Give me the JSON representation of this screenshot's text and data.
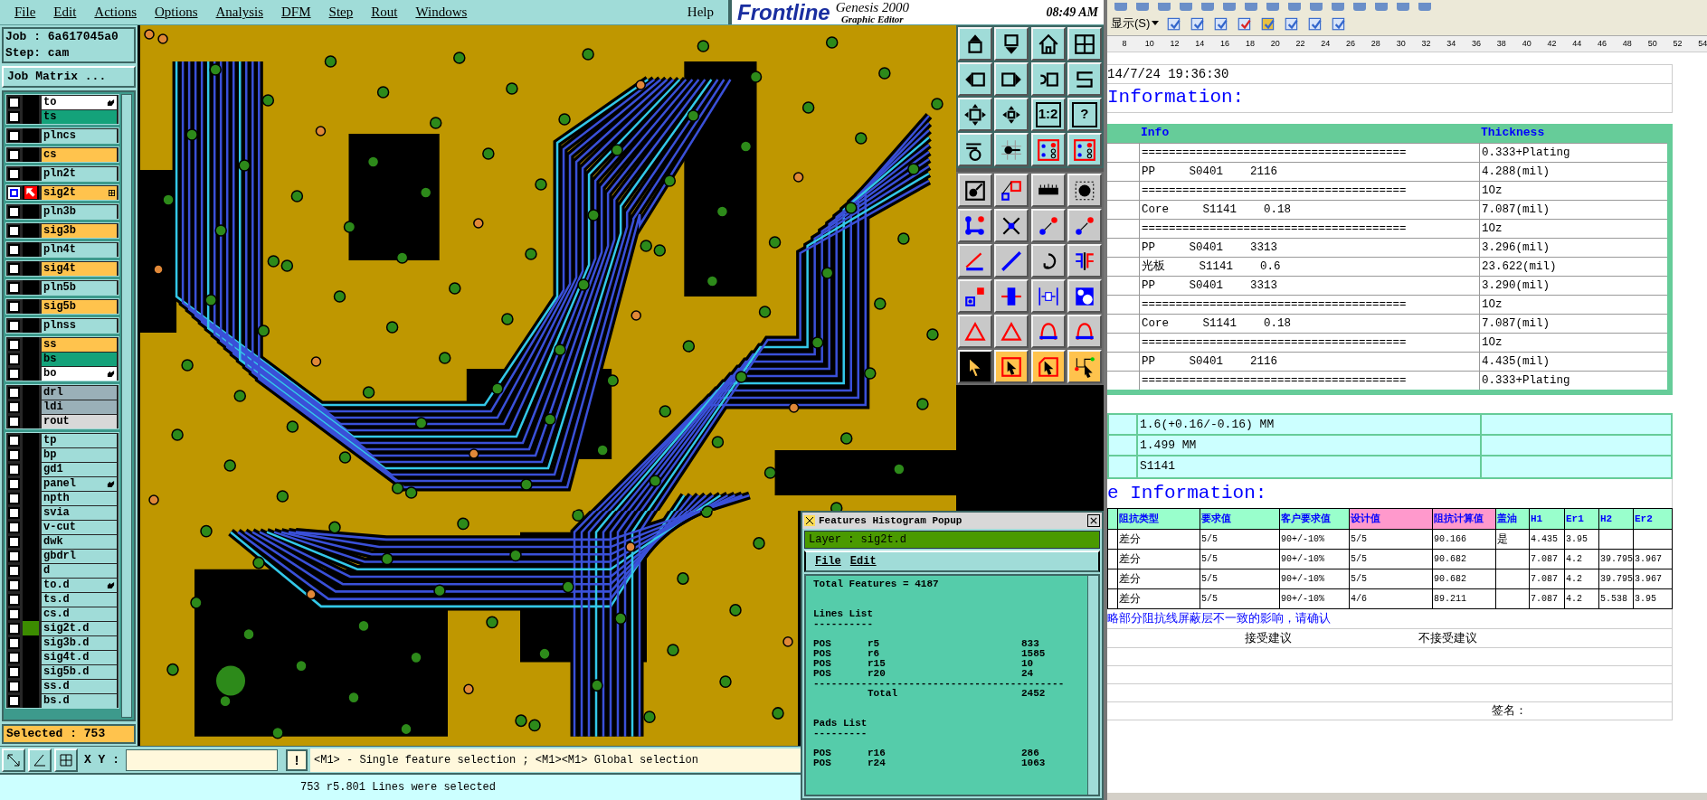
{
  "menu": [
    {
      "label": "File"
    },
    {
      "label": "Edit"
    },
    {
      "label": "Actions"
    },
    {
      "label": "Options"
    },
    {
      "label": "Analysis"
    },
    {
      "label": "DFM"
    },
    {
      "label": "Step"
    },
    {
      "label": "Rout"
    },
    {
      "label": "Windows"
    }
  ],
  "help": "Help",
  "brand": {
    "logo": "Frontline",
    "product": "Genesis 2000",
    "subtitle": "Graphic Editor",
    "clock": "08:49 AM"
  },
  "job": {
    "job": "Job :  6a617045a0",
    "step": "Step: cam",
    "matrix_button": "Job Matrix ..."
  },
  "layer_groups": [
    {
      "layers": [
        {
          "name": "to",
          "color": "#ffffff",
          "selected": false,
          "hand": true,
          "displayed": false
        },
        {
          "name": "ts",
          "color": "#14a27a",
          "selected": false,
          "hand": false,
          "displayed": false
        }
      ]
    },
    {
      "layers": [
        {
          "name": "plncs",
          "color": "#a0dcd8",
          "selected": false,
          "hand": false,
          "displayed": false
        }
      ]
    },
    {
      "layers": [
        {
          "name": "cs",
          "color": "#ffc34d",
          "selected": false,
          "hand": false,
          "displayed": false
        }
      ]
    },
    {
      "layers": [
        {
          "name": "pln2t",
          "color": "#a0dcd8",
          "selected": false,
          "hand": false,
          "displayed": false
        }
      ]
    },
    {
      "layers": [
        {
          "name": "sig2t",
          "color": "#ffc34d",
          "selected": true,
          "hand": false,
          "displayed": false
        }
      ]
    },
    {
      "layers": [
        {
          "name": "pln3b",
          "color": "#a0dcd8",
          "selected": false,
          "hand": false,
          "displayed": false
        }
      ]
    },
    {
      "layers": [
        {
          "name": "sig3b",
          "color": "#ffc34d",
          "selected": false,
          "hand": false,
          "displayed": false
        }
      ]
    },
    {
      "layers": [
        {
          "name": "pln4t",
          "color": "#a0dcd8",
          "selected": false,
          "hand": false,
          "displayed": false
        }
      ]
    },
    {
      "layers": [
        {
          "name": "sig4t",
          "color": "#ffc34d",
          "selected": false,
          "hand": false,
          "displayed": false
        }
      ]
    },
    {
      "layers": [
        {
          "name": "pln5b",
          "color": "#a0dcd8",
          "selected": false,
          "hand": false,
          "displayed": false
        }
      ]
    },
    {
      "layers": [
        {
          "name": "sig5b",
          "color": "#ffc34d",
          "selected": false,
          "hand": false,
          "displayed": false
        }
      ]
    },
    {
      "layers": [
        {
          "name": "plnss",
          "color": "#a0dcd8",
          "selected": false,
          "hand": false,
          "displayed": false
        }
      ]
    },
    {
      "layers": [
        {
          "name": "ss",
          "color": "#ffc34d",
          "selected": false,
          "hand": false,
          "displayed": false
        },
        {
          "name": "bs",
          "color": "#14a27a",
          "selected": false,
          "hand": false,
          "displayed": false
        },
        {
          "name": "bo",
          "color": "#ffffff",
          "selected": false,
          "hand": true,
          "displayed": false
        }
      ]
    },
    {
      "layers": [
        {
          "name": "drl",
          "color": "#9ab0b8",
          "selected": false,
          "hand": false,
          "displayed": false
        },
        {
          "name": "ldi",
          "color": "#9ab0b8",
          "selected": false,
          "hand": false,
          "displayed": false
        },
        {
          "name": "rout",
          "color": "#d8d8d8",
          "selected": false,
          "hand": false,
          "displayed": false
        }
      ]
    },
    {
      "layers": [
        {
          "name": "tp",
          "color": "#a0dcd8",
          "selected": false,
          "hand": false,
          "displayed": false
        },
        {
          "name": "bp",
          "color": "#a0dcd8",
          "selected": false,
          "hand": false,
          "displayed": false
        },
        {
          "name": "gd1",
          "color": "#a0dcd8",
          "selected": false,
          "hand": false,
          "displayed": false
        },
        {
          "name": "panel",
          "color": "#a0dcd8",
          "selected": false,
          "hand": true,
          "displayed": false
        },
        {
          "name": "npth",
          "color": "#a0dcd8",
          "selected": false,
          "hand": false,
          "displayed": false
        },
        {
          "name": "svia",
          "color": "#a0dcd8",
          "selected": false,
          "hand": false,
          "displayed": false
        },
        {
          "name": "v-cut",
          "color": "#a0dcd8",
          "selected": false,
          "hand": false,
          "displayed": false
        },
        {
          "name": "dwk",
          "color": "#a0dcd8",
          "selected": false,
          "hand": false,
          "displayed": false
        },
        {
          "name": "gbdrl",
          "color": "#a0dcd8",
          "selected": false,
          "hand": false,
          "displayed": false
        },
        {
          "name": "d",
          "color": "#a0dcd8",
          "selected": false,
          "hand": false,
          "displayed": false
        },
        {
          "name": "to.d",
          "color": "#a0dcd8",
          "selected": false,
          "hand": true,
          "displayed": false
        },
        {
          "name": "ts.d",
          "color": "#a0dcd8",
          "selected": false,
          "hand": false,
          "displayed": false
        },
        {
          "name": "cs.d",
          "color": "#a0dcd8",
          "selected": false,
          "hand": false,
          "displayed": false
        },
        {
          "name": "sig2t.d",
          "color": "#a0dcd8",
          "selected": false,
          "hand": false,
          "displayed": true
        },
        {
          "name": "sig3b.d",
          "color": "#a0dcd8",
          "selected": false,
          "hand": false,
          "displayed": false
        },
        {
          "name": "sig4t.d",
          "color": "#a0dcd8",
          "selected": false,
          "hand": false,
          "displayed": false
        },
        {
          "name": "sig5b.d",
          "color": "#a0dcd8",
          "selected": false,
          "hand": false,
          "displayed": false
        },
        {
          "name": "ss.d",
          "color": "#a0dcd8",
          "selected": false,
          "hand": false,
          "displayed": false
        },
        {
          "name": "bs.d",
          "color": "#a0dcd8",
          "selected": false,
          "hand": false,
          "displayed": false
        }
      ]
    }
  ],
  "selected_count": "Selected : 753",
  "view_tools": [
    {
      "kind": "box-up",
      "selected": false
    },
    {
      "kind": "box-down",
      "selected": false
    },
    {
      "kind": "house",
      "selected": false
    },
    {
      "kind": "window",
      "selected": false
    },
    {
      "kind": "box-left",
      "selected": false
    },
    {
      "kind": "box-right",
      "selected": false
    },
    {
      "kind": "undo-box",
      "selected": false
    },
    {
      "kind": "route",
      "selected": false
    },
    {
      "kind": "expand",
      "selected": false
    },
    {
      "kind": "shrink",
      "selected": false
    },
    {
      "kind": "text",
      "selected": false,
      "label": "1:2"
    },
    {
      "kind": "text",
      "selected": false,
      "label": "?"
    },
    {
      "kind": "wrench",
      "selected": false
    },
    {
      "kind": "pad-grid",
      "selected": false
    },
    {
      "kind": "board",
      "selected": false
    },
    {
      "kind": "board",
      "selected": false
    }
  ],
  "edit_tools": [
    {
      "kind": "pad-move",
      "selected": false
    },
    {
      "kind": "copy-box",
      "selected": false
    },
    {
      "kind": "ruler",
      "selected": false
    },
    {
      "kind": "pad-frame",
      "selected": false
    },
    {
      "kind": "nodes",
      "selected": false
    },
    {
      "kind": "cross",
      "selected": false
    },
    {
      "kind": "node-link",
      "selected": false
    },
    {
      "kind": "node-link",
      "selected": false
    },
    {
      "kind": "line-red",
      "selected": false
    },
    {
      "kind": "line-blue",
      "selected": false
    },
    {
      "kind": "rotate",
      "selected": false
    },
    {
      "kind": "mirror",
      "selected": false
    },
    {
      "kind": "pad-copy",
      "selected": false
    },
    {
      "kind": "line-join",
      "selected": false
    },
    {
      "kind": "spacing",
      "selected": false
    },
    {
      "kind": "blob",
      "selected": false
    },
    {
      "kind": "triangle",
      "selected": false
    },
    {
      "kind": "triangle",
      "selected": false
    },
    {
      "kind": "arch",
      "selected": false
    },
    {
      "kind": "arch",
      "selected": false
    }
  ],
  "select_tools": [
    {
      "kind": "select-arrow",
      "selected": true
    },
    {
      "kind": "select-box",
      "selected": false
    },
    {
      "kind": "select-poly",
      "selected": false
    },
    {
      "kind": "select-net",
      "selected": false
    }
  ],
  "alert_button": "!",
  "xy": {
    "label": "X Y :"
  },
  "hint": "<M1> - Single feature selection ; <M1><M1> Global selection",
  "status": "753 r5.801 Lines were selected",
  "popup": {
    "title": "Features Histogram Popup",
    "layer": "Layer :  sig2t.d",
    "menu": [
      "File",
      "Edit"
    ],
    "total": "Total Features = 4187",
    "sections": [
      {
        "title": "Lines List",
        "underline": "----------",
        "rows": [
          [
            "POS",
            "r5",
            "833"
          ],
          [
            "POS",
            "r6",
            "1585"
          ],
          [
            "POS",
            "r15",
            "10"
          ],
          [
            "POS",
            "r20",
            "24"
          ]
        ],
        "separator": "------------------------------------------",
        "total_label": "Total",
        "total": "2452"
      },
      {
        "title": "Pads List",
        "underline": "---------",
        "rows": [
          [
            "POS",
            "r16",
            "286"
          ],
          [
            "POS",
            "r24",
            "1063"
          ]
        ]
      }
    ]
  },
  "doc": {
    "view_menu": "显示(S)",
    "ruler": [
      "8",
      "10",
      "12",
      "14",
      "16",
      "18",
      "20",
      "22",
      "24",
      "26",
      "28",
      "30",
      "32",
      "34",
      "36",
      "38",
      "40",
      "42",
      "44",
      "46",
      "48",
      "50",
      "52",
      "54"
    ],
    "date": "14/7/24 19:36:30",
    "heading1": "Information:",
    "stack": {
      "columns": [
        "Info",
        "Thickness"
      ],
      "rows": [
        [
          "=======================================",
          "0.333+Plating"
        ],
        [
          "PP     S0401    2116",
          "4.288(mil)"
        ],
        [
          "=======================================",
          "1Oz"
        ],
        [
          "Core     S1141    0.18",
          "7.087(mil)"
        ],
        [
          "=======================================",
          "1Oz"
        ],
        [
          "PP     S0401    3313",
          "3.296(mil)"
        ],
        [
          "光板     S1141    0.6",
          "23.622(mil)"
        ],
        [
          "PP     S0401    3313",
          "3.290(mil)"
        ],
        [
          "=======================================",
          "1Oz"
        ],
        [
          "Core     S1141    0.18",
          "7.087(mil)"
        ],
        [
          "=======================================",
          "1Oz"
        ],
        [
          "PP     S0401    2116",
          "4.435(mil)"
        ],
        [
          "=======================================",
          "0.333+Plating"
        ]
      ]
    },
    "board": [
      "1.6(+0.16/-0.16) MM",
      "1.499 MM",
      "S1141"
    ],
    "heading2": "e Information:",
    "impedance": {
      "columns": [
        {
          "label": "阻抗类型",
          "highlight": false
        },
        {
          "label": "要求值",
          "highlight": false
        },
        {
          "label": "客户要求值",
          "highlight": false
        },
        {
          "label": "设计值",
          "highlight": true
        },
        {
          "label": "阻抗计算值",
          "highlight": true
        },
        {
          "label": "盖油",
          "highlight": false
        },
        {
          "label": "H1",
          "highlight": false
        },
        {
          "label": "Er1",
          "highlight": false
        },
        {
          "label": "H2",
          "highlight": false
        },
        {
          "label": "Er2",
          "highlight": false
        }
      ],
      "rows": [
        [
          "差分",
          "5/5",
          "90+/-10%",
          "5/5",
          "90.166",
          "是",
          "4.435",
          "3.95",
          null,
          null
        ],
        [
          "差分",
          "5/5",
          "90+/-10%",
          "5/5",
          "90.682",
          null,
          "7.087",
          "4.2",
          "39.795",
          "3.967"
        ],
        [
          "差分",
          "5/5",
          "90+/-10%",
          "5/5",
          "90.682",
          null,
          "7.087",
          "4.2",
          "39.795",
          "3.967"
        ],
        [
          "差分",
          "5/5",
          "90+/-10%",
          "4/6",
          "89.211",
          null,
          "7.087",
          "4.2",
          "5.538",
          "3.95"
        ]
      ]
    },
    "note": "略部分阻抗线屏蔽层不一致的影响，请确认",
    "accept": "接受建议",
    "reject": "不接受建议",
    "signature": "签名："
  }
}
